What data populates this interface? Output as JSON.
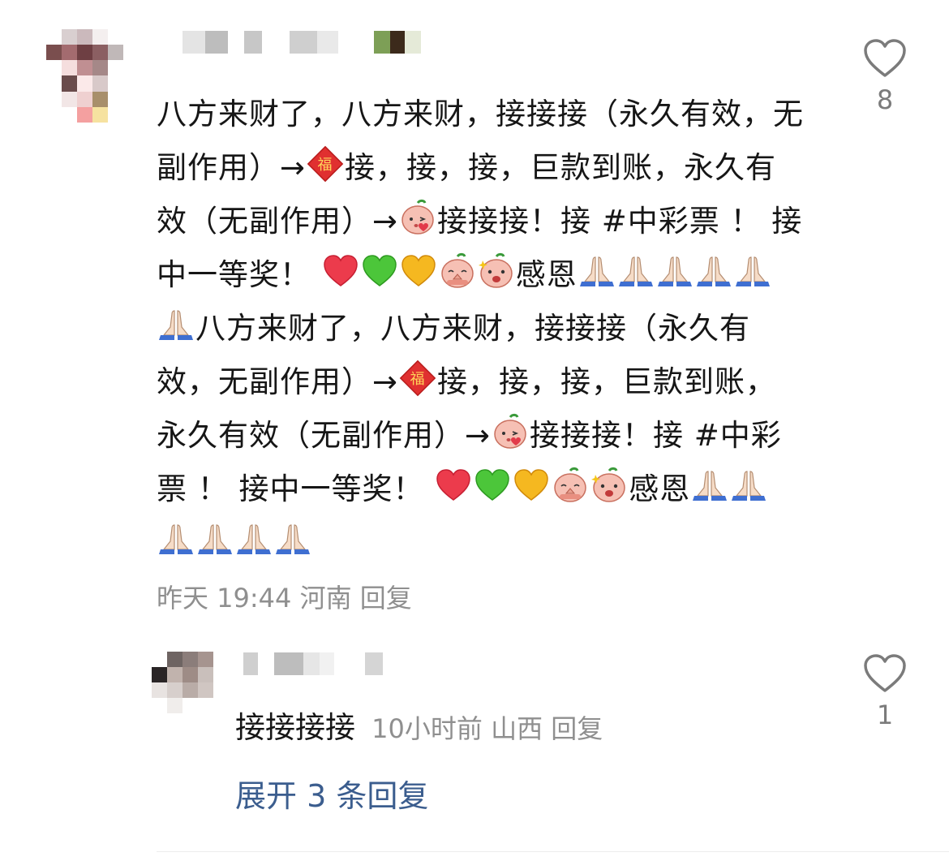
{
  "comment": {
    "segments": [
      {
        "t": "text",
        "v": "八方来财了，八方来财，接接接（永久有效，无副作用）→"
      },
      {
        "t": "emoji",
        "name": "fu-icon"
      },
      {
        "t": "text",
        "v": "接，接，接，巨款到账，永久有效（无副作用）→"
      },
      {
        "t": "emoji",
        "name": "kiss-face-icon"
      },
      {
        "t": "text",
        "v": "接接接！接 #中彩票 ！ 接中一等奖！ "
      },
      {
        "t": "emoji",
        "name": "red-heart-icon"
      },
      {
        "t": "emoji",
        "name": "green-heart-icon"
      },
      {
        "t": "emoji",
        "name": "yellow-heart-icon"
      },
      {
        "t": "emoji",
        "name": "praying-face-icon"
      },
      {
        "t": "emoji",
        "name": "excited-face-icon"
      },
      {
        "t": "text",
        "v": "感恩"
      },
      {
        "t": "emoji",
        "name": "folded-hands-icon"
      },
      {
        "t": "emoji",
        "name": "folded-hands-icon"
      },
      {
        "t": "emoji",
        "name": "folded-hands-icon"
      },
      {
        "t": "emoji",
        "name": "folded-hands-icon"
      },
      {
        "t": "emoji",
        "name": "folded-hands-icon"
      },
      {
        "t": "emoji",
        "name": "folded-hands-icon"
      },
      {
        "t": "text",
        "v": "八方来财了，八方来财，接接接（永久有效，无副作用）→"
      },
      {
        "t": "emoji",
        "name": "fu-icon"
      },
      {
        "t": "text",
        "v": "接，接，接，巨款到账，永久有效（无副作用）→"
      },
      {
        "t": "emoji",
        "name": "kiss-face-icon"
      },
      {
        "t": "text",
        "v": "接接接！接 #中彩票 ！ 接中一等奖！ "
      },
      {
        "t": "emoji",
        "name": "red-heart-icon"
      },
      {
        "t": "emoji",
        "name": "green-heart-icon"
      },
      {
        "t": "emoji",
        "name": "yellow-heart-icon"
      },
      {
        "t": "emoji",
        "name": "praying-face-icon"
      },
      {
        "t": "emoji",
        "name": "excited-face-icon"
      },
      {
        "t": "text",
        "v": "感恩"
      },
      {
        "t": "emoji",
        "name": "folded-hands-icon"
      },
      {
        "t": "emoji",
        "name": "folded-hands-icon"
      },
      {
        "t": "emoji",
        "name": "folded-hands-icon"
      },
      {
        "t": "emoji",
        "name": "folded-hands-icon"
      },
      {
        "t": "emoji",
        "name": "folded-hands-icon"
      },
      {
        "t": "emoji",
        "name": "folded-hands-icon"
      }
    ],
    "time": "昨天 19:44",
    "location": "河南",
    "reply_label": "回复",
    "like_count": "8"
  },
  "reply": {
    "text": "接接接接",
    "time": "10小时前",
    "location": "山西",
    "reply_label": "回复",
    "like_count": "1"
  },
  "expand_label": "展开 3 条回复"
}
